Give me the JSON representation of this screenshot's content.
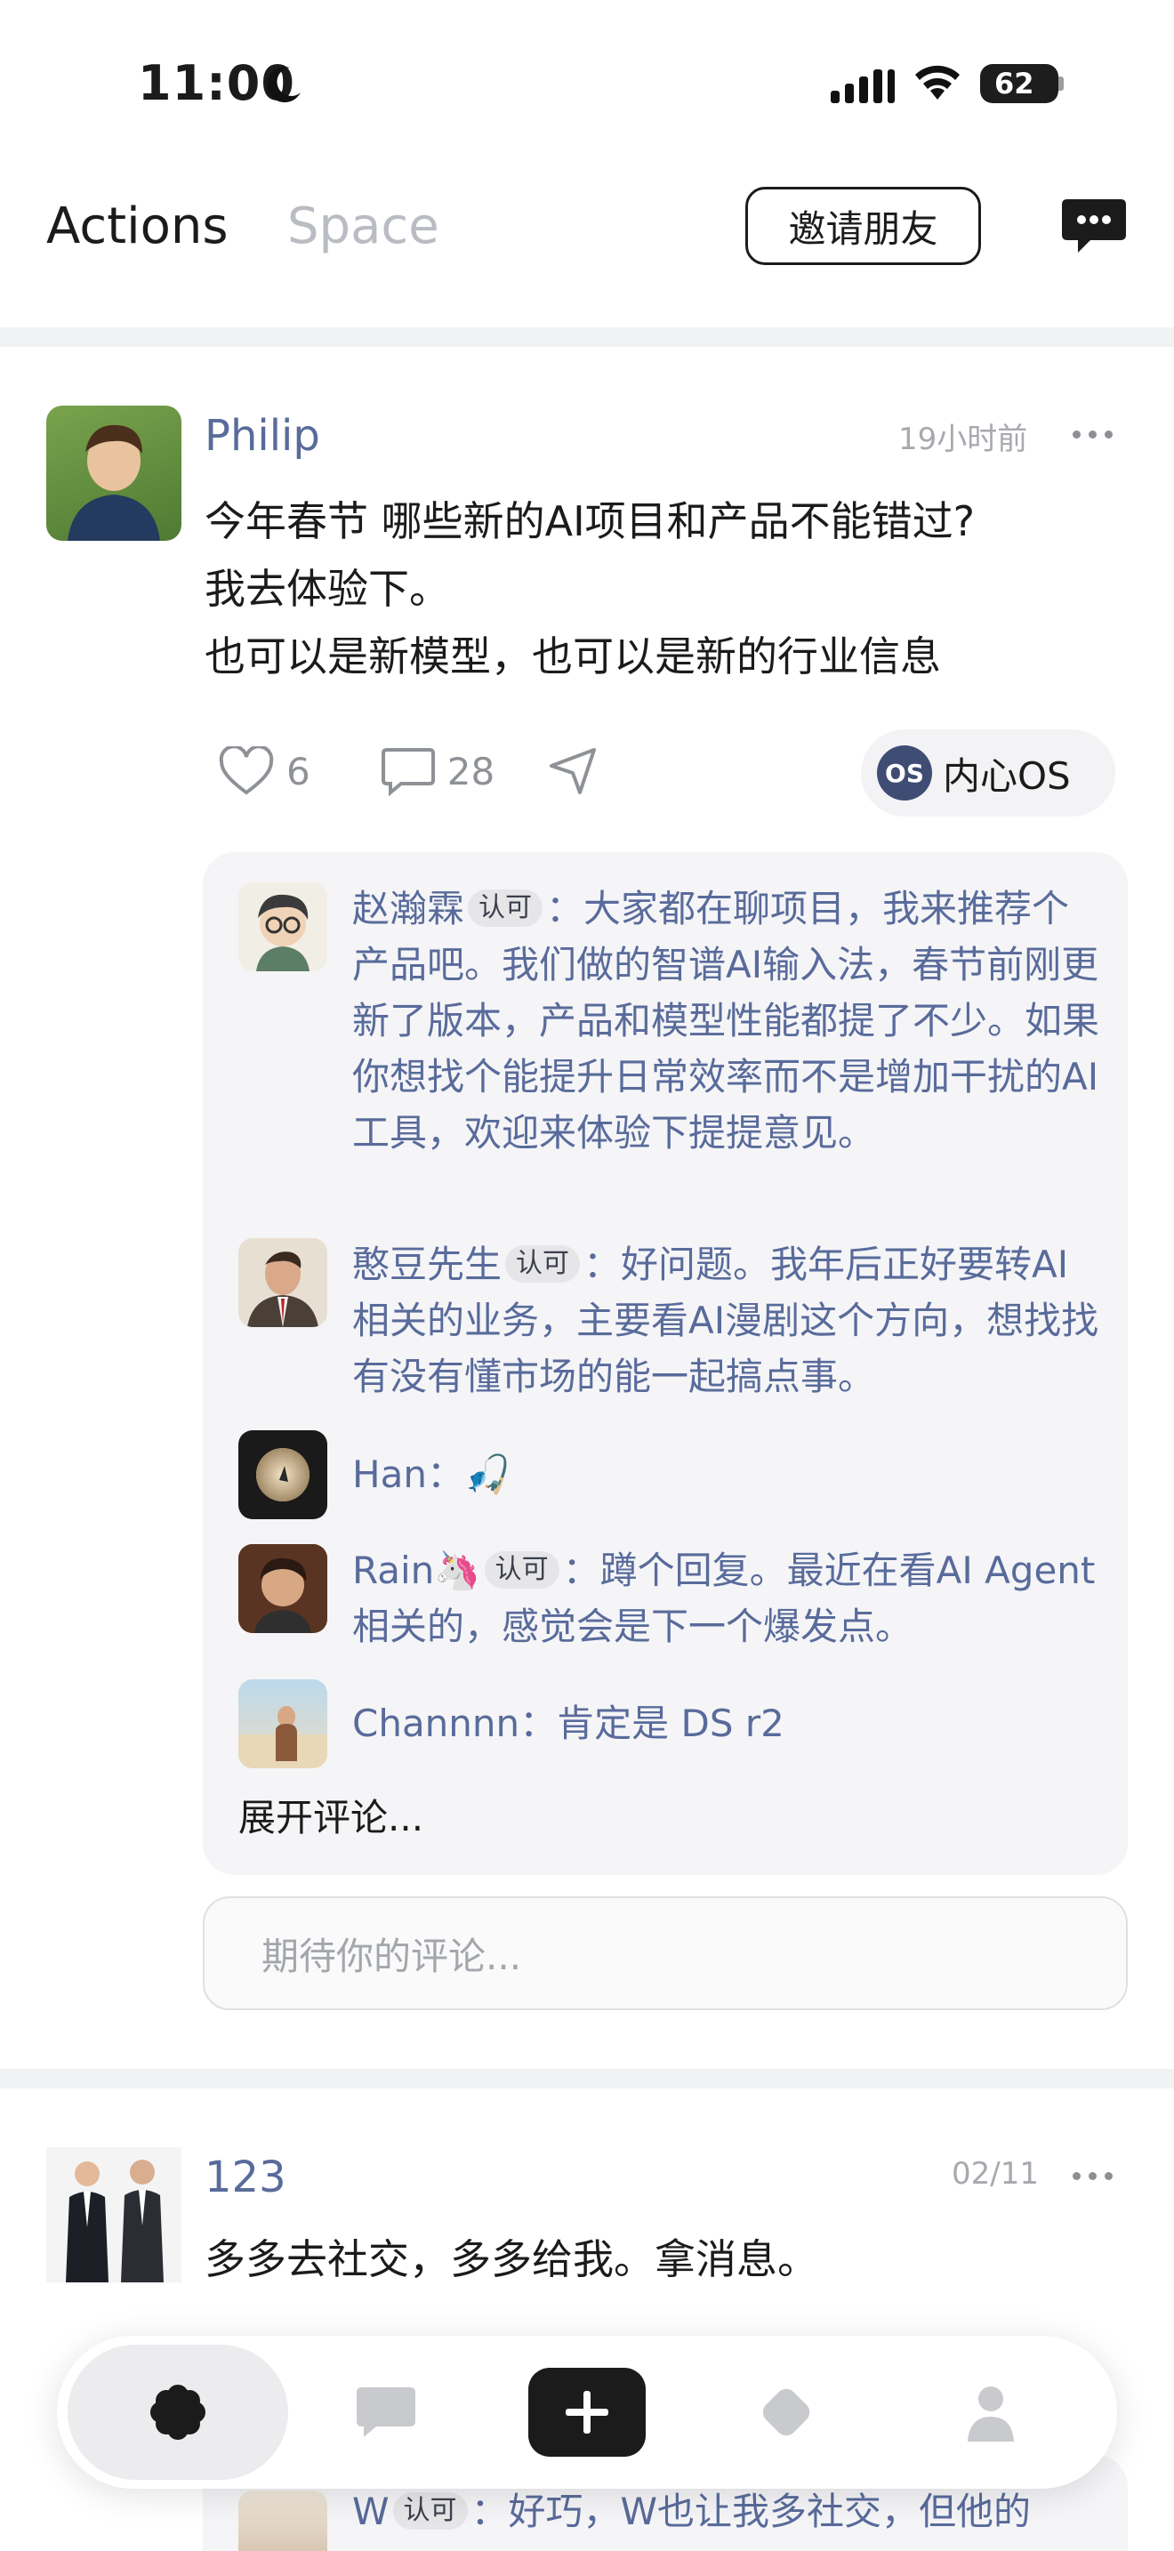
{
  "status_bar": {
    "time": "11:00",
    "battery": "62"
  },
  "header": {
    "tabs": [
      {
        "label": "Actions",
        "active": true
      },
      {
        "label": "Space",
        "active": false
      }
    ],
    "invite_label": "邀请朋友"
  },
  "posts": [
    {
      "author": "Philip",
      "time": "19小时前",
      "lines": [
        "今年春节 哪些新的AI项目和产品不能错过?",
        "我去体验下。",
        "也可以是新模型，也可以是新的行业信息"
      ],
      "likes": "6",
      "comments_count": "28",
      "os_chip": {
        "icon": "OS",
        "label": "内心OS"
      },
      "comments": [
        {
          "name": "赵瀚霖",
          "badge": "认可",
          "text": "：大家都在聊项目，我来推荐个产品吧。我们做的智谱AI输入法，春节前刚更新了版本，产品和模型性能都提了不少。如果你想找个能提升日常效率而不是增加干扰的AI工具，欢迎来体验下提提意见。"
        },
        {
          "name": "憨豆先生",
          "badge": "认可",
          "text": "：好问题。我年后正好要转AI相关的业务，主要看AI漫剧这个方向，想找找有没有懂市场的能一起搞点事。"
        },
        {
          "name": "Han",
          "badge": "",
          "text": "：🎣"
        },
        {
          "name": "Rain🦄",
          "badge": "认可",
          "text": "：蹲个回复。最近在看AI Agent相关的，感觉会是下一个爆发点。"
        },
        {
          "name": "Channnn",
          "badge": "",
          "text": "：肯定是 DS r2"
        }
      ],
      "expand_label": "展开评论...",
      "comment_placeholder": "期待你的评论..."
    },
    {
      "author": "123",
      "time": "02/11",
      "lines": [
        "多多去社交，多多给我。拿消息。"
      ],
      "comments": [
        {
          "name": "W",
          "badge": "认可",
          "text": "：好巧，W也让我多社交，但他的"
        }
      ]
    }
  ],
  "colors": {
    "accent_name": "#596b9b",
    "muted": "#a6a9ae",
    "os_icon": "#3f4c74",
    "nav_active_bg": "#ececee"
  },
  "icons": [
    "moon-icon",
    "signal-icon",
    "wifi-icon",
    "chat-bubble-icon",
    "heart-icon",
    "comment-icon",
    "share-icon",
    "flower-icon",
    "message-icon",
    "plus-icon",
    "diamond-icon",
    "profile-icon"
  ]
}
